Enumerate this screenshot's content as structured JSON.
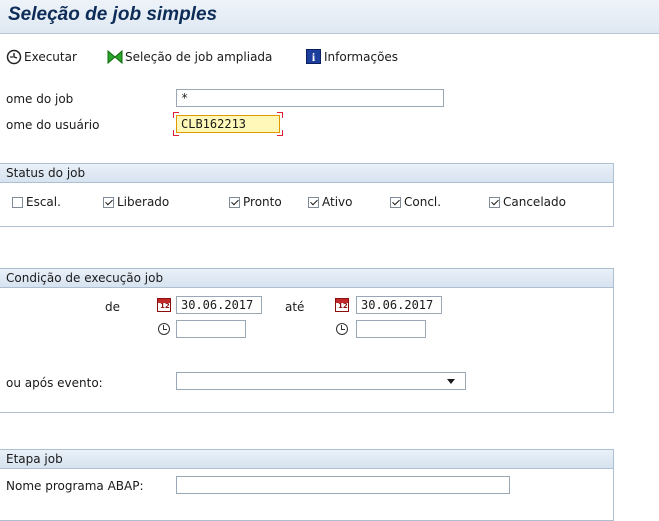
{
  "window": {
    "title": "Seleção de job simples"
  },
  "toolbar": {
    "execute_label": "Executar",
    "extended_selection_label": "Seleção de job ampliada",
    "info_label": "Informações",
    "info_icon_letter": "i"
  },
  "fields": {
    "job_name_label": "ome do job",
    "job_name_value": "*",
    "user_name_label": "ome do usuário",
    "user_name_value": "CLB162213"
  },
  "status_group": {
    "title": "Status do job",
    "options": [
      {
        "label": "Escal.",
        "checked": false
      },
      {
        "label": "Liberado",
        "checked": true
      },
      {
        "label": "Pronto",
        "checked": true
      },
      {
        "label": "Ativo",
        "checked": true
      },
      {
        "label": "Concl.",
        "checked": true
      },
      {
        "label": "Cancelado",
        "checked": true
      }
    ]
  },
  "exec_group": {
    "title": "Condição de execução job",
    "from_label": "de",
    "to_label": "até",
    "from_date": "30.06.2017",
    "to_date": "30.06.2017",
    "from_time": "",
    "to_time": "",
    "after_event_label": "ou após evento:",
    "after_event_value": "",
    "calendar_icon_text": "12"
  },
  "step_group": {
    "title": "Etapa job",
    "abap_program_label": "Nome programa ABAP:",
    "abap_program_value": ""
  },
  "colors": {
    "title_text": "#0d2c57",
    "group_header": "#d7e3f0",
    "focused_field": "#fff8b8"
  },
  "icons": {
    "execute": "execute-clock-icon",
    "extended_selection": "green-bowtie-icon",
    "info": "info-icon",
    "calendar": "calendar-icon",
    "clock": "clock-icon",
    "dropdown": "chevron-down-icon"
  }
}
